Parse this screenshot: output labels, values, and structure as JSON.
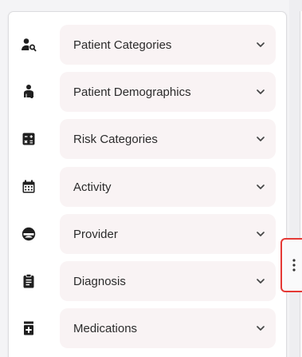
{
  "filters": [
    {
      "label": "Patient Categories",
      "icon": "patient-search-icon"
    },
    {
      "label": "Patient Demographics",
      "icon": "person-demographics-icon"
    },
    {
      "label": "Risk Categories",
      "icon": "calculator-icon"
    },
    {
      "label": "Activity",
      "icon": "calendar-icon"
    },
    {
      "label": "Provider",
      "icon": "account-circle-icon"
    },
    {
      "label": "Diagnosis",
      "icon": "clipboard-icon"
    },
    {
      "label": "Medications",
      "icon": "medicine-box-icon"
    }
  ],
  "colors": {
    "pill_background": "#f9f3f4",
    "highlight_border": "#e53935",
    "icon": "#1f1f1f"
  },
  "resize_handle_icon": "vertical-dots-icon"
}
